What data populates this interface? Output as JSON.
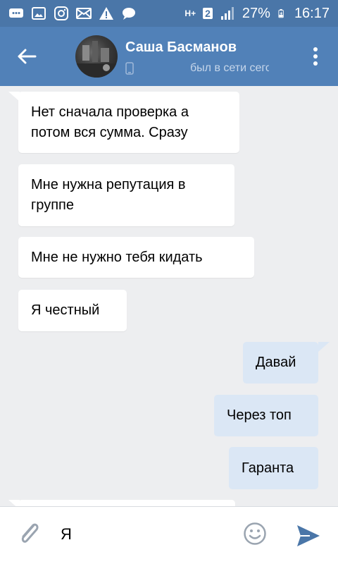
{
  "status_bar": {
    "battery": "27%",
    "time": "16:17",
    "network": "H+",
    "sim_badge": "2"
  },
  "header": {
    "name": "Саша Басманов",
    "status": "был в сети сегодня"
  },
  "messages": [
    {
      "direction": "in",
      "text": "Нет сначала проверка а потом вся сумма. Сразу"
    },
    {
      "direction": "in",
      "text": "Мне нужна репутация в группе"
    },
    {
      "direction": "in",
      "text": "Мне не нужно тебя кидать"
    },
    {
      "direction": "in",
      "text": "Я честный"
    },
    {
      "direction": "out",
      "text": "Давай"
    },
    {
      "direction": "out",
      "text": "Через топ"
    },
    {
      "direction": "out",
      "text": "Гаранта"
    }
  ],
  "composer": {
    "value": "Я"
  },
  "colors": {
    "header": "#5181b8",
    "status_bar": "#4a76a8",
    "incoming_bubble": "#ffffff",
    "outgoing_bubble": "#dbe7f5",
    "background": "#edeef0",
    "send": "#4a76a8"
  },
  "icons": [
    "chat-icon",
    "gallery-icon",
    "instagram-icon",
    "mail-icon",
    "warning-icon",
    "message-icon",
    "signal-icon",
    "battery-icon",
    "back-arrow-icon",
    "phone-icon",
    "more-vert-icon",
    "paperclip-icon",
    "emoji-icon",
    "send-icon"
  ]
}
